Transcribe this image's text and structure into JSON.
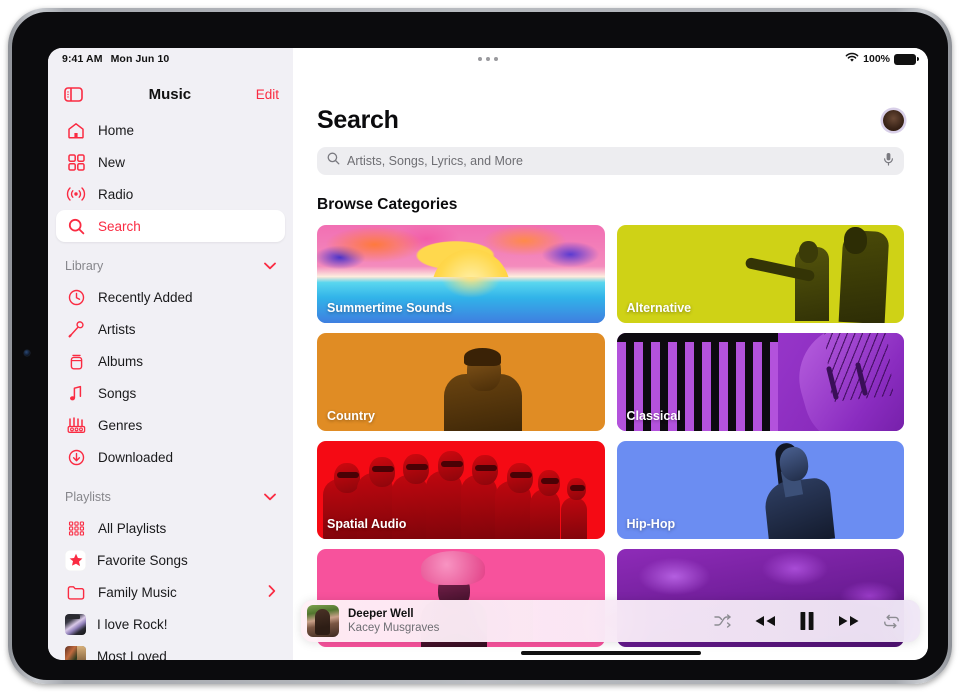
{
  "status_bar": {
    "time": "9:41 AM",
    "date": "Mon Jun 10",
    "wifi_icon": "wifi-icon",
    "battery_percent": "100%",
    "battery_icon": "battery-full-icon",
    "multitask_icon": "multitask-dots-icon"
  },
  "sidebar": {
    "toggle_icon": "sidebar-toggle-icon",
    "title": "Music",
    "edit_label": "Edit",
    "top_items": [
      {
        "label": "Home",
        "icon": "home-icon",
        "selected": false
      },
      {
        "label": "New",
        "icon": "grid-squares-icon",
        "selected": false
      },
      {
        "label": "Radio",
        "icon": "radio-waves-icon",
        "selected": false
      },
      {
        "label": "Search",
        "icon": "magnifier-icon",
        "selected": true
      }
    ],
    "library_section": {
      "label": "Library",
      "chevron_icon": "chevron-down-icon",
      "items": [
        {
          "label": "Recently Added",
          "icon": "clock-icon"
        },
        {
          "label": "Artists",
          "icon": "microphone-icon"
        },
        {
          "label": "Albums",
          "icon": "album-stack-icon"
        },
        {
          "label": "Songs",
          "icon": "music-note-icon"
        },
        {
          "label": "Genres",
          "icon": "genres-icon"
        },
        {
          "label": "Downloaded",
          "icon": "download-arrow-icon"
        }
      ]
    },
    "playlists_section": {
      "label": "Playlists",
      "chevron_icon": "chevron-down-icon",
      "items": [
        {
          "label": "All Playlists",
          "icon": "playlist-grid-icon",
          "disclosure": false
        },
        {
          "label": "Favorite Songs",
          "icon": "star-icon",
          "disclosure": false
        },
        {
          "label": "Family Music",
          "icon": "folder-icon",
          "disclosure": true,
          "disclosure_icon": "chevron-right-icon"
        },
        {
          "label": "I love Rock!",
          "icon": "playlist-artwork-rock",
          "disclosure": false
        },
        {
          "label": "Most Loved",
          "icon": "playlist-artwork-loved",
          "disclosure": false
        }
      ]
    }
  },
  "main": {
    "page_title": "Search",
    "avatar_icon": "user-avatar",
    "search": {
      "placeholder": "Artists, Songs, Lyrics, and More",
      "value": "",
      "search_icon": "magnifier-icon",
      "mic_icon": "microphone-icon"
    },
    "browse_heading": "Browse Categories",
    "categories": [
      {
        "label": "Summertime Sounds",
        "art": "summer"
      },
      {
        "label": "Alternative",
        "art": "alt"
      },
      {
        "label": "Country",
        "art": "country"
      },
      {
        "label": "Classical",
        "art": "classical"
      },
      {
        "label": "Spatial Audio",
        "art": "spatial"
      },
      {
        "label": "Hip-Hop",
        "art": "hiphop"
      },
      {
        "label": "",
        "art": "pink"
      },
      {
        "label": "",
        "art": "purple"
      }
    ]
  },
  "now_playing": {
    "artwork_icon": "album-artwork",
    "title": "Deeper Well",
    "artist": "Kacey Musgraves",
    "controls": [
      {
        "name": "shuffle-button",
        "icon": "shuffle-icon"
      },
      {
        "name": "previous-button",
        "icon": "rewind-icon"
      },
      {
        "name": "play-pause-button",
        "icon": "pause-icon"
      },
      {
        "name": "next-button",
        "icon": "fast-forward-icon"
      },
      {
        "name": "repeat-button",
        "icon": "repeat-icon"
      }
    ]
  },
  "colors": {
    "accent_red": "#fa2b42",
    "sidebar_bg": "#f1f0f5",
    "text_primary": "#0b0b0d",
    "text_secondary": "#6e6e73"
  }
}
